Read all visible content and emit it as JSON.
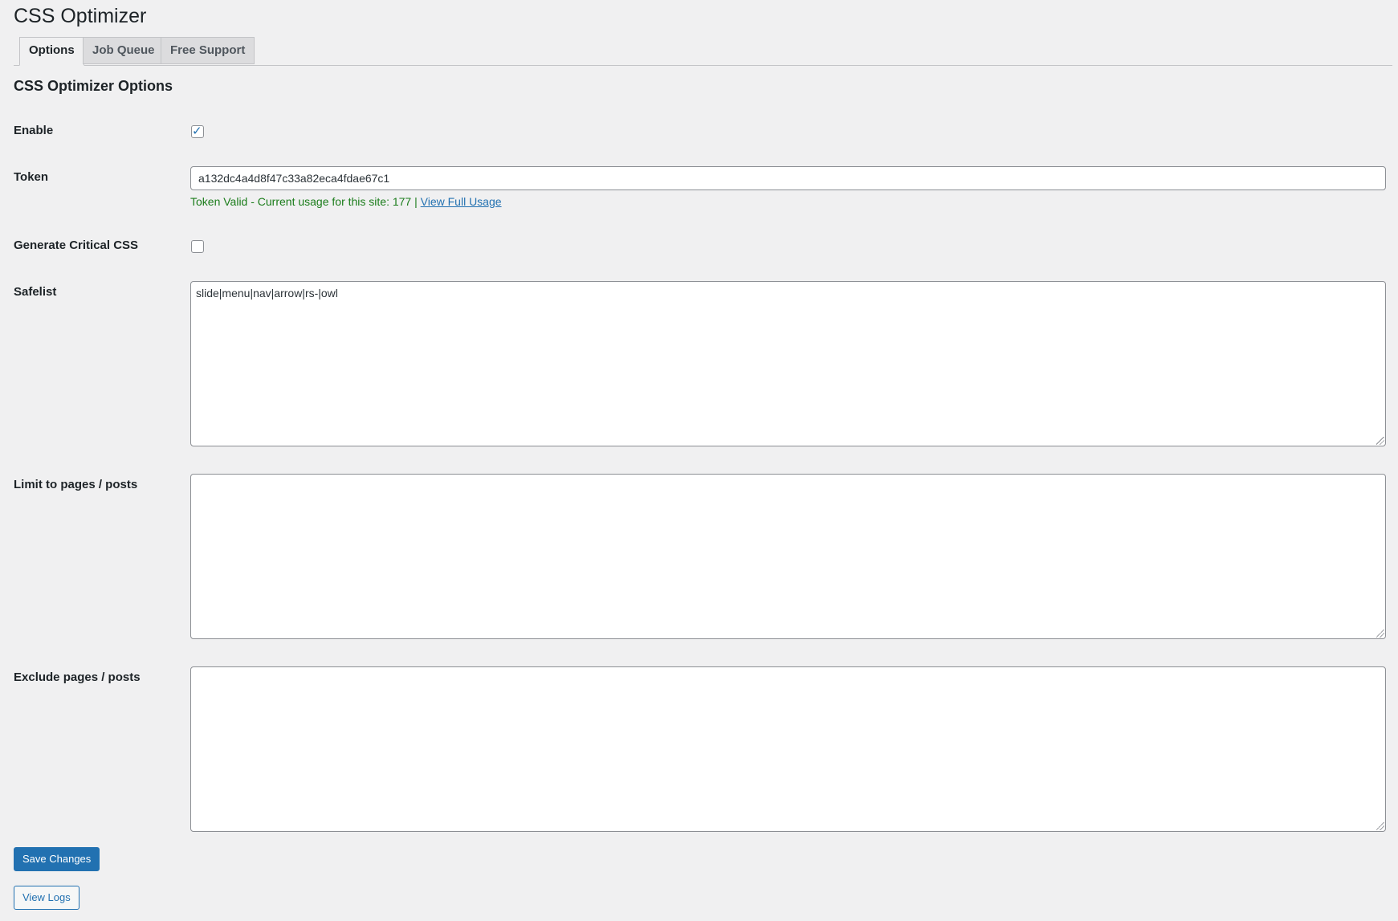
{
  "page": {
    "title": "CSS Optimizer",
    "section_title": "CSS Optimizer Options"
  },
  "tabs": [
    {
      "label": "Options",
      "active": true
    },
    {
      "label": "Job Queue",
      "active": false
    },
    {
      "label": "Free Support",
      "active": false
    }
  ],
  "fields": {
    "enable": {
      "label": "Enable",
      "checked": true
    },
    "token": {
      "label": "Token",
      "value": "a132dc4a4d8f47c33a82eca4fdae67c1",
      "status_text": "Token Valid - Current usage for this site: 177 |",
      "usage_link": "View Full Usage"
    },
    "critical_css": {
      "label": "Generate Critical CSS",
      "checked": false
    },
    "safelist": {
      "label": "Safelist",
      "value": "slide|menu|nav|arrow|rs-|owl"
    },
    "limit_pages": {
      "label": "Limit to pages / posts",
      "value": ""
    },
    "exclude_pages": {
      "label": "Exclude pages / posts",
      "value": ""
    }
  },
  "buttons": {
    "save": "Save Changes",
    "view_logs": "View Logs"
  },
  "colors": {
    "background": "#f0f0f1",
    "primary": "#2271b1",
    "success_text": "#1a7c1a"
  },
  "icons": {
    "checkmark": "checkmark-icon"
  }
}
